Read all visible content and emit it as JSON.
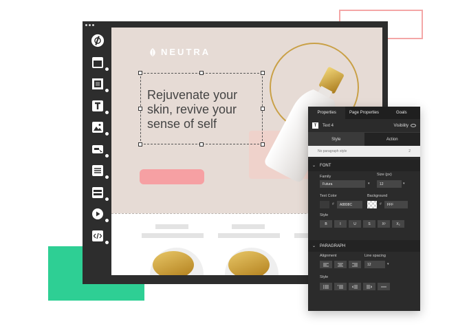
{
  "colors": {
    "editor_bg": "#2d2d2d",
    "hero_bg": "#e6dbd5",
    "cta": "#f6a0a3",
    "accent_outline": "#f4a6a6",
    "accent_green": "#2ecf94",
    "panel_bg": "#2b2b2b"
  },
  "tools": [
    {
      "name": "logo-icon"
    },
    {
      "name": "section-icon"
    },
    {
      "name": "image-block-icon"
    },
    {
      "name": "text-icon"
    },
    {
      "name": "image-icon"
    },
    {
      "name": "button-icon"
    },
    {
      "name": "list-icon"
    },
    {
      "name": "form-icon"
    },
    {
      "name": "video-icon"
    },
    {
      "name": "code-icon"
    }
  ],
  "canvas": {
    "brand": "NEUTRA",
    "headline": "Rejuvenate your skin, revive your sense of self"
  },
  "panel": {
    "tabs": [
      "Properties",
      "Page Properties",
      "Goals"
    ],
    "element_badge": "T",
    "element_name": "Text 4",
    "visibility_label": "Visibility",
    "subtabs": [
      "Style",
      "Action"
    ],
    "paragraph_style": "No paragraph style",
    "paragraph_style_count": "2",
    "font_section": "FONT",
    "family_label": "Family",
    "family_value": "Futura",
    "size_label": "Size (px)",
    "size_value": "12",
    "text_color_label": "Text Color",
    "text_color_value": "A8808C",
    "background_label": "Background",
    "background_value": "FFF",
    "style_label": "Style",
    "font_style_buttons": [
      "B",
      "I",
      "U",
      "S",
      "X²",
      "X₂"
    ],
    "paragraph_section": "PARAGRAPH",
    "alignment_label": "Alignment",
    "line_spacing_label": "Line spacing",
    "line_spacing_value": "12",
    "paragraph_style_label": "Style"
  }
}
